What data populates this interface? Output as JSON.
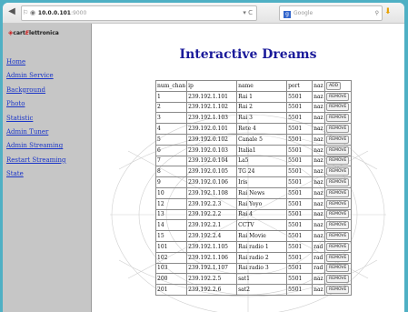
{
  "browser": {
    "back_glyph": "◀",
    "url_host": "10.0.0.101",
    "url_port": ":9000",
    "reload_glyph": "▾ C",
    "search_engine_glyph": "g",
    "search_placeholder": "Google",
    "search_glyph": "⚲"
  },
  "logo": {
    "mark": "◈",
    "brand_a": "cart",
    "brand_e": "E",
    "brand_b": "lettronica"
  },
  "sidebar": {
    "items": [
      {
        "label": "Home"
      },
      {
        "label": "Admin Service"
      },
      {
        "label": "Background"
      },
      {
        "label": "Photo"
      },
      {
        "label": "Statistic"
      },
      {
        "label": "Admin Tuner"
      },
      {
        "label": "Admin Streaming"
      },
      {
        "label": "Restart Streaming"
      },
      {
        "label": "State"
      }
    ]
  },
  "main": {
    "title": "Interactive Dreams",
    "columns": [
      "num_chan",
      "ip",
      "name",
      "port",
      "naz"
    ],
    "add_label": "ADD",
    "remove_label": "REMOVE",
    "rows": [
      {
        "num": "1",
        "ip": "239.192.1.101",
        "name": "Rai 1",
        "port": "5501",
        "naz": "naz"
      },
      {
        "num": "2",
        "ip": "239.192.1.102",
        "name": "Rai 2",
        "port": "5501",
        "naz": "naz"
      },
      {
        "num": "3",
        "ip": "239.192.1.103",
        "name": "Rai 3",
        "port": "5501",
        "naz": "naz"
      },
      {
        "num": "4",
        "ip": "239.192.0.101",
        "name": "Rete 4",
        "port": "5501",
        "naz": "naz"
      },
      {
        "num": "5",
        "ip": "239.192.0.102",
        "name": "Canale 5",
        "port": "5501",
        "naz": "naz"
      },
      {
        "num": "6",
        "ip": "239.192.0.103",
        "name": "Italia1",
        "port": "5501",
        "naz": "naz"
      },
      {
        "num": "7",
        "ip": "239.192.0.104",
        "name": "La5",
        "port": "5501",
        "naz": "naz"
      },
      {
        "num": "8",
        "ip": "239.192.0.105",
        "name": "TG 24",
        "port": "5501",
        "naz": "naz"
      },
      {
        "num": "9",
        "ip": "239.192.0.106",
        "name": "Iris",
        "port": "5501",
        "naz": "naz"
      },
      {
        "num": "10",
        "ip": "239.192.1.108",
        "name": "Rai News",
        "port": "5501",
        "naz": "naz"
      },
      {
        "num": "12",
        "ip": "239.192.2.3",
        "name": "Rai Yoyo",
        "port": "5501",
        "naz": "naz"
      },
      {
        "num": "13",
        "ip": "239.192.2.2",
        "name": "Rai 4",
        "port": "5501",
        "naz": "naz"
      },
      {
        "num": "14",
        "ip": "239.192.2.1",
        "name": "CCTV",
        "port": "5501",
        "naz": "naz"
      },
      {
        "num": "15",
        "ip": "239.192.2.4",
        "name": "Rai Movie",
        "port": "5501",
        "naz": "naz"
      },
      {
        "num": "101",
        "ip": "239.192.1.105",
        "name": "Rai radio 1",
        "port": "5501",
        "naz": "rad"
      },
      {
        "num": "102",
        "ip": "239.192.1.106",
        "name": "Rai radio 2",
        "port": "5501",
        "naz": "rad"
      },
      {
        "num": "103",
        "ip": "239.192.1.107",
        "name": "Rai radio 3",
        "port": "5501",
        "naz": "rad"
      },
      {
        "num": "200",
        "ip": "239.192.2.5",
        "name": "sat1",
        "port": "5501",
        "naz": "naz"
      },
      {
        "num": "201",
        "ip": "239.192.2.6",
        "name": "sat2",
        "port": "5501",
        "naz": "naz"
      }
    ]
  }
}
